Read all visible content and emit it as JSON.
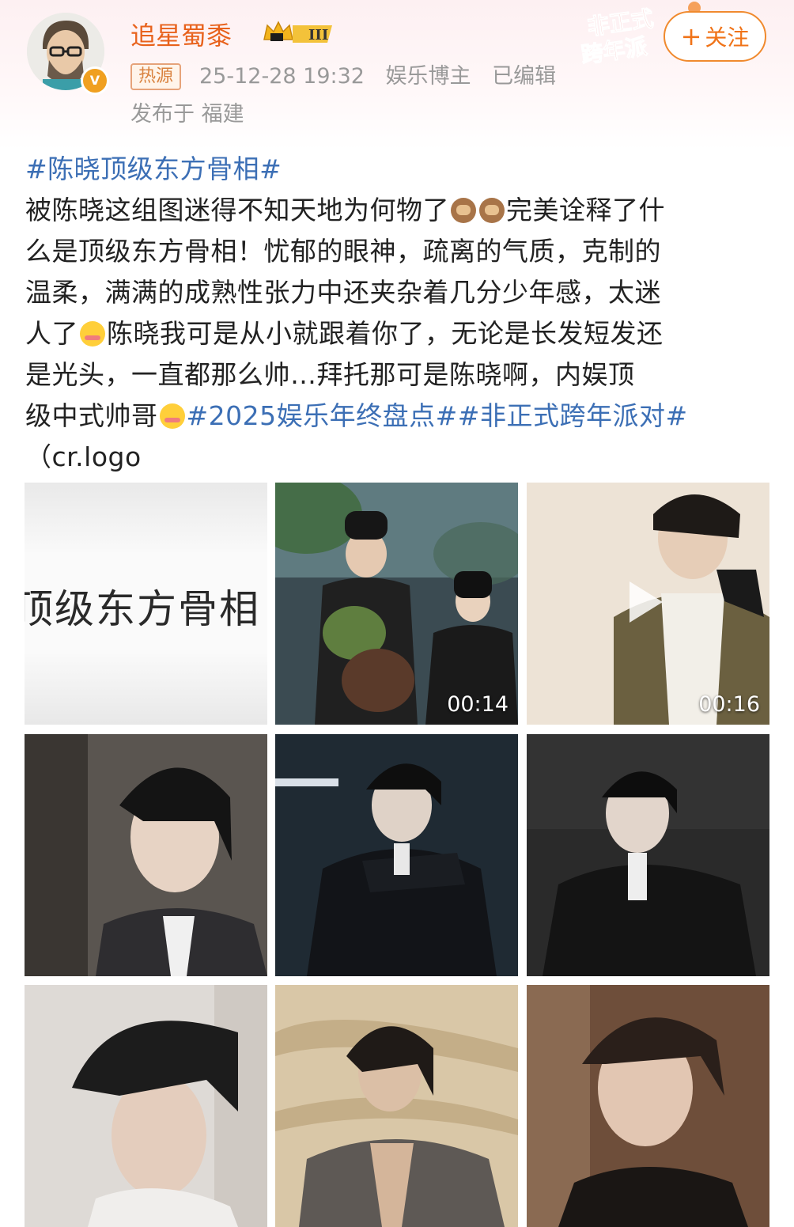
{
  "header": {
    "username": "追星蜀黍",
    "level_badge": "III",
    "hot_tag": "热源",
    "timestamp": "25-12-28 19:32",
    "category": "娱乐博主",
    "edited": "已编辑",
    "location": "发布于 福建",
    "follow_label": "关注",
    "follow_icon": "plus-icon",
    "party_banner": "非正式跨年派",
    "brand_color": "#e8621c",
    "hashtag_color": "#3c6fb5"
  },
  "post": {
    "hashtag_1": "#陈晓顶级东方骨相#",
    "line1a": "被陈晓这组图迷得不知天地为何物了",
    "line1b": "完美诠释了什",
    "line2": "么是顶级东方骨相！忧郁的眼神，疏离的气质，克制的",
    "line3": "温柔，满满的成熟性张力中还夹杂着几分少年感，太迷",
    "line4a": "人了",
    "line4b": "陈晓我可是从小就跟着你了，无论是长发短发还",
    "line5": "是光头，一直都那么帅…拜托那可是陈晓啊，内娱顶",
    "line6a": "级中式帅哥",
    "hashtag_2": "#2025娱乐年终盘点#",
    "hashtag_3": "#非正式跨年派对#",
    "line7": "（cr.logo"
  },
  "media": {
    "cover_text": "顶级东方骨相",
    "video_1_duration": "00:14",
    "video_2_duration": "00:16"
  }
}
